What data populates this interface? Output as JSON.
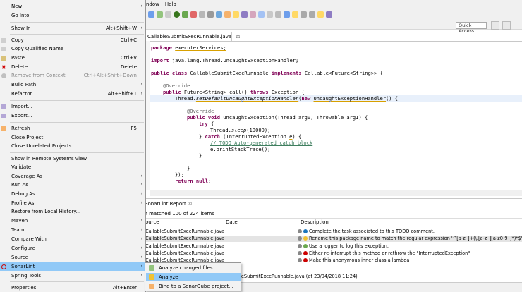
{
  "window": {
    "menus": [
      "ndow",
      "Help"
    ],
    "quick_access": "Quick Access"
  },
  "editor": {
    "tab_label": "CallableSubmitExecRunnable.java",
    "tab_close": "☒",
    "lines": {
      "l1_kw": "package",
      "l1_rest": "executerServices;",
      "l2_kw": "import",
      "l2_rest": "java.lang.Thread.UncaughtExceptionHandler;",
      "l3_kw1": "public class",
      "l3_name": "CallableSubmitExecRunnable",
      "l3_kw2": "implements",
      "l3_rest": "Callable<Future<String>> {",
      "l4": "@Override",
      "l5_kw": "public",
      "l5_mid": "Future<String> call()",
      "l5_kw2": "throws",
      "l5_rest": "Exception {",
      "l6_a": "Thread.",
      "l6_b": "setDefaultUncaughtExceptionHandler",
      "l6_c": "(",
      "l6_kw": "new",
      "l6_d": "UncaughtExceptionHandler",
      "l6_e": "() {",
      "l7": "@Override",
      "l8_kw": "public void",
      "l8_rest": "uncaughtException(Thread arg0, Throwable arg1) {",
      "l9_kw": "try",
      "l9_rest": "{",
      "l10_a": "Thread.",
      "l10_b": "sleep",
      "l10_c": "(10000);",
      "l11_a": "} ",
      "l11_kw": "catch",
      "l11_b": " (InterruptedException ",
      "l11_c": "e",
      "l11_d": ") {",
      "l12": "// TODO Auto-generated catch block",
      "l13_a": "e.",
      "l13_b": "printStackTrace",
      "l13_c": "();",
      "l14": "}",
      "l15": "}",
      "l16": "});",
      "l17_kw": "return null",
      "l17_rest": ";"
    }
  },
  "panel": {
    "tab_label": "SonarLint Report",
    "matched": "r matched 100 of 224 items",
    "headers": {
      "source": "ource",
      "date": "Date",
      "description": "Description"
    },
    "rows": [
      {
        "file": "CallableSubmitExecRunnable.java",
        "desc": "Complete the task associated to this TODO comment.",
        "color": "#1b75bc"
      },
      {
        "file": "CallableSubmitExecRunnable.java",
        "desc": "Rename this package name to match the regular expression '^[a-z_]+(\\.[a-z_][a-z0-9_]*)*$'.",
        "color": "#f1c232"
      },
      {
        "file": "CallableSubmitExecRunnable.java",
        "desc": "Use a logger to log this exception.",
        "color": "#6aa84f"
      },
      {
        "file": "CallableSubmitExecRunnable.java",
        "desc": "Either re-interrupt this method or rethrow the \"InterruptedException\".",
        "color": "#cc0000"
      },
      {
        "file": "CallableSubmitExecRunnable.java",
        "desc": "Make this anonymous inner class a lambda",
        "color": "#cc0000"
      }
    ],
    "status_line": "leSubmitExecRunnable.java (at 23/04/2018 11:24)"
  },
  "context_menu": {
    "items": [
      {
        "label": "New",
        "shortcut": "",
        "arrow": true
      },
      {
        "label": "Go Into",
        "shortcut": "",
        "arrow": false
      },
      {
        "label": "Show In",
        "shortcut": "Alt+Shift+W",
        "arrow": true
      },
      {
        "label": "Copy",
        "shortcut": "Ctrl+C",
        "arrow": false
      },
      {
        "label": "Copy Qualified Name",
        "shortcut": "",
        "arrow": false
      },
      {
        "label": "Paste",
        "shortcut": "Ctrl+V",
        "arrow": false
      },
      {
        "label": "Delete",
        "shortcut": "Delete",
        "arrow": false
      },
      {
        "label": "Remove from Context",
        "shortcut": "Ctrl+Alt+Shift+Down",
        "arrow": false
      },
      {
        "label": "Build Path",
        "shortcut": "",
        "arrow": true
      },
      {
        "label": "Refactor",
        "shortcut": "Alt+Shift+T",
        "arrow": true
      },
      {
        "label": "Import...",
        "shortcut": "",
        "arrow": false
      },
      {
        "label": "Export...",
        "shortcut": "",
        "arrow": false
      },
      {
        "label": "Refresh",
        "shortcut": "F5",
        "arrow": false
      },
      {
        "label": "Close Project",
        "shortcut": "",
        "arrow": false
      },
      {
        "label": "Close Unrelated Projects",
        "shortcut": "",
        "arrow": false
      },
      {
        "label": "Show in Remote Systems view",
        "shortcut": "",
        "arrow": false
      },
      {
        "label": "Validate",
        "shortcut": "",
        "arrow": false
      },
      {
        "label": "Coverage As",
        "shortcut": "",
        "arrow": true
      },
      {
        "label": "Run As",
        "shortcut": "",
        "arrow": true
      },
      {
        "label": "Debug As",
        "shortcut": "",
        "arrow": true
      },
      {
        "label": "Profile As",
        "shortcut": "",
        "arrow": true
      },
      {
        "label": "Restore from Local History...",
        "shortcut": "",
        "arrow": false
      },
      {
        "label": "Maven",
        "shortcut": "",
        "arrow": true
      },
      {
        "label": "Team",
        "shortcut": "",
        "arrow": true
      },
      {
        "label": "Compare With",
        "shortcut": "",
        "arrow": true
      },
      {
        "label": "Configure",
        "shortcut": "",
        "arrow": true
      },
      {
        "label": "Source",
        "shortcut": "",
        "arrow": true
      },
      {
        "label": "SonarLint",
        "shortcut": "",
        "arrow": true
      },
      {
        "label": "Spring Tools",
        "shortcut": "",
        "arrow": true
      },
      {
        "label": "Properties",
        "shortcut": "Alt+Enter",
        "arrow": false
      }
    ],
    "arrow_glyph": "›"
  },
  "submenu": {
    "items": [
      "Analyze changed files",
      "Analyze",
      "Bind to a SonarQube project..."
    ]
  }
}
